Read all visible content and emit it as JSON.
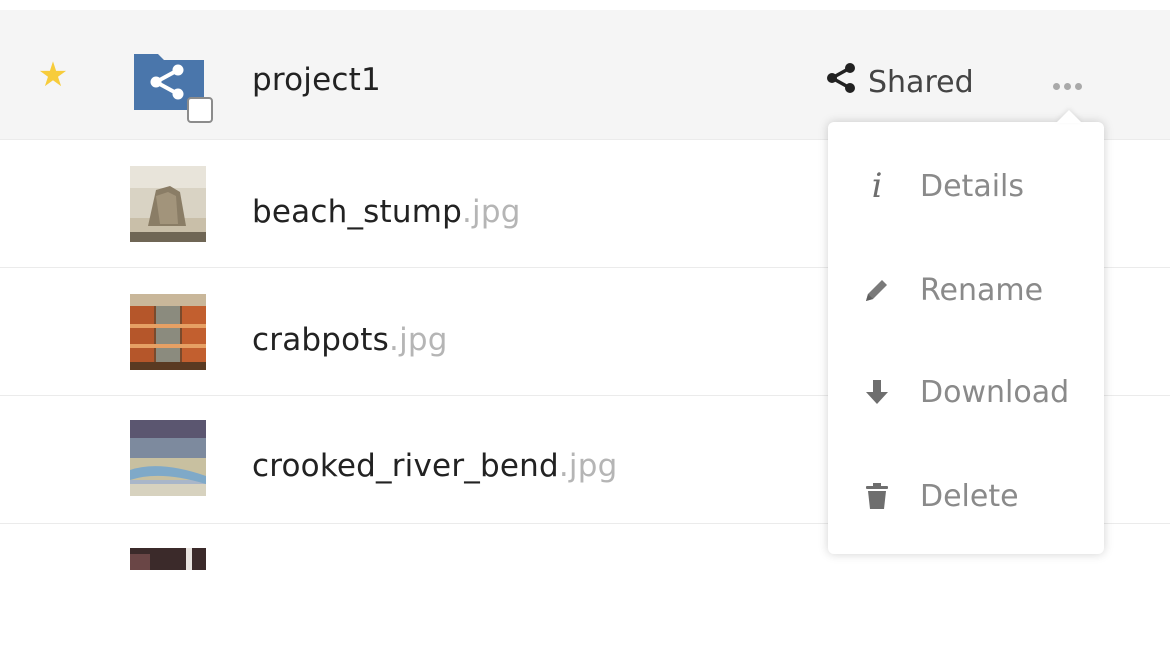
{
  "files": [
    {
      "basename": "project1",
      "extension": "",
      "favorite": true,
      "selected": true,
      "icon": "shared-folder-icon",
      "share_label": "Shared"
    },
    {
      "basename": "beach_stump",
      "extension": ".jpg",
      "icon": "image-thumbnail"
    },
    {
      "basename": "crabpots",
      "extension": ".jpg",
      "icon": "image-thumbnail"
    },
    {
      "basename": "crooked_river_bend",
      "extension": ".jpg",
      "icon": "image-thumbnail"
    }
  ],
  "actions_menu": {
    "items": [
      {
        "label": "Details",
        "icon": "info-icon"
      },
      {
        "label": "Rename",
        "icon": "pencil-icon"
      },
      {
        "label": "Download",
        "icon": "download-icon"
      },
      {
        "label": "Delete",
        "icon": "trash-icon"
      }
    ]
  },
  "colors": {
    "favorite_star": "#f7cc3b",
    "folder": "#4a76ab",
    "extension_text": "#b5b5b5",
    "menu_text": "#8a8a8a",
    "selected_row": "#f5f5f5"
  }
}
